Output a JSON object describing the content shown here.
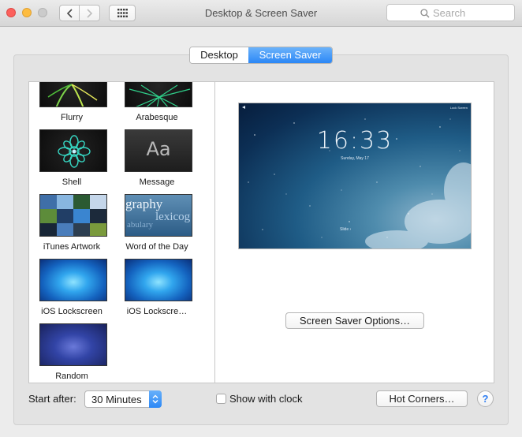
{
  "window": {
    "title": "Desktop & Screen Saver",
    "search_placeholder": "Search"
  },
  "tabs": [
    {
      "label": "Desktop",
      "selected": false
    },
    {
      "label": "Screen Saver",
      "selected": true
    }
  ],
  "screensavers": [
    {
      "name": "Flurry",
      "icon": "flurry-thumbnail"
    },
    {
      "name": "Arabesque",
      "icon": "arabesque-thumbnail"
    },
    {
      "name": "Shell",
      "icon": "shell-thumbnail"
    },
    {
      "name": "Message",
      "icon": "message-thumbnail",
      "thumb_text": "Aa"
    },
    {
      "name": "iTunes Artwork",
      "icon": "itunes-artwork-thumbnail"
    },
    {
      "name": "Word of the Day",
      "icon": "word-of-the-day-thumbnail",
      "thumb_words": [
        "graphy",
        "lexicog",
        "abulary"
      ]
    },
    {
      "name": "iOS Lockscreen",
      "icon": "ios-lockscreen-thumbnail"
    },
    {
      "name": "iOS Lockscre…",
      "icon": "ios-lockscreen-thumbnail"
    },
    {
      "name": "Random",
      "icon": "random-thumbnail"
    }
  ],
  "preview": {
    "time": "16:33",
    "date": "Sunday, May 17",
    "slide_hint": "Slide ›",
    "corner_text": "Lock Screen"
  },
  "buttons": {
    "options": "Screen Saver Options…",
    "hot_corners": "Hot Corners…",
    "help": "?"
  },
  "start_after": {
    "label": "Start after:",
    "value": "30 Minutes"
  },
  "show_with_clock": {
    "label": "Show with clock",
    "checked": false
  },
  "colors": {
    "accent": "#2b87f6",
    "close": "#fc605c",
    "minimize": "#fdbc40",
    "zoom": "#cbcbcb"
  }
}
